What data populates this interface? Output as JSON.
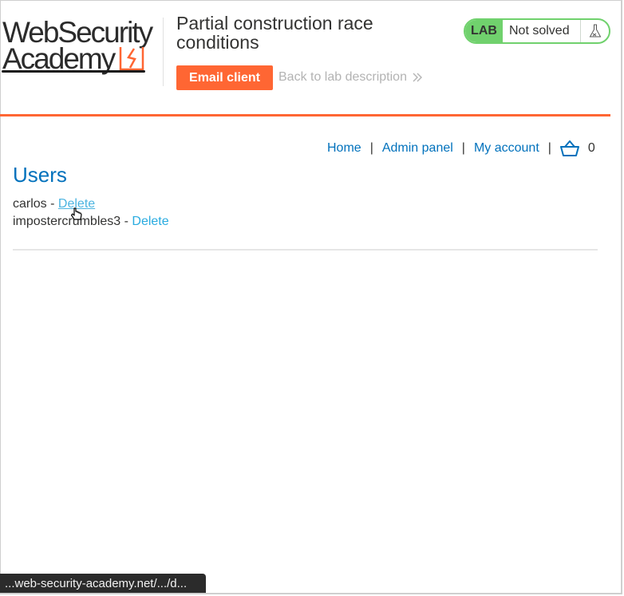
{
  "logo": {
    "line1": "WebSecurity",
    "line2": "Academy"
  },
  "lab": {
    "title": "Partial construction race conditions",
    "email_client": "Email client",
    "back_link": "Back to lab description",
    "badge": "LAB",
    "status": "Not solved"
  },
  "nav": {
    "home": "Home",
    "admin_panel": "Admin panel",
    "my_account": "My account",
    "separator": "|",
    "cart_count": "0"
  },
  "main": {
    "heading": "Users",
    "users": [
      {
        "name": "carlos",
        "dash": " - ",
        "action": "Delete"
      },
      {
        "name": "imposterc",
        "name_tail": "rumbles3",
        "dash": " - ",
        "action": "Delete"
      }
    ]
  },
  "statusbar": {
    "url": "...web-security-academy.net/.../d..."
  },
  "colors": {
    "accent": "#ff6633",
    "link": "#0071bc",
    "solved_green": "#70d16d"
  }
}
